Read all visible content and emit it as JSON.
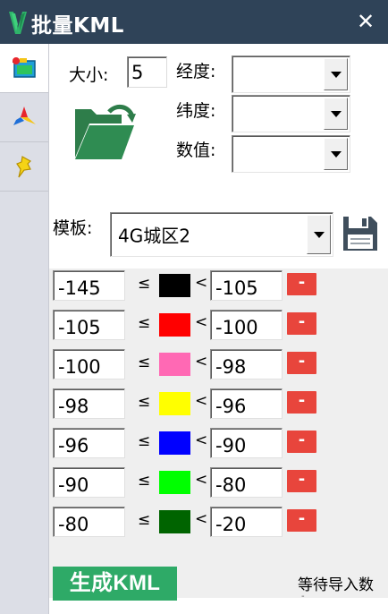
{
  "window": {
    "title": "批量KML",
    "close_glyph": "✕"
  },
  "sidebar": {
    "tabs": [
      {
        "name": "batch-kml-tab",
        "icon": "batch-kml-icon",
        "active": true
      },
      {
        "name": "color-tab",
        "icon": "color-triad-icon",
        "active": false
      },
      {
        "name": "pin-tab",
        "icon": "pushpin-icon",
        "active": false
      }
    ]
  },
  "form": {
    "size_label": "大小:",
    "size_value": "5",
    "longitude_label": "经度:",
    "latitude_label": "纬度:",
    "value_label": "数值:",
    "template_label": "模板:",
    "template_value": "4G城区2"
  },
  "ranges": [
    {
      "min": "-145",
      "le": "≤",
      "color": "#000000",
      "lt": "<",
      "max": "-105",
      "delete": "-"
    },
    {
      "min": "-105",
      "le": "≤",
      "color": "#ff0000",
      "lt": "<",
      "max": "-100",
      "delete": "-"
    },
    {
      "min": "-100",
      "le": "≤",
      "color": "#ff69b4",
      "lt": "<",
      "max": "-98",
      "delete": "-"
    },
    {
      "min": "-98",
      "le": "≤",
      "color": "#ffff00",
      "lt": "<",
      "max": "-96",
      "delete": "-"
    },
    {
      "min": "-96",
      "le": "≤",
      "color": "#0000ff",
      "lt": "<",
      "max": "-90",
      "delete": "-"
    },
    {
      "min": "-90",
      "le": "≤",
      "color": "#00ff00",
      "lt": "<",
      "max": "-80",
      "delete": "-"
    },
    {
      "min": "-80",
      "le": "≤",
      "color": "#006400",
      "lt": "<",
      "max": "-20",
      "delete": "-"
    }
  ],
  "footer": {
    "generate_label": "生成KML",
    "status": "等待导入数",
    "status_dash": "-"
  },
  "colors": {
    "titlebar": "#2f4358",
    "generate_button": "#2eaa67",
    "delete_button": "#e8453c"
  }
}
